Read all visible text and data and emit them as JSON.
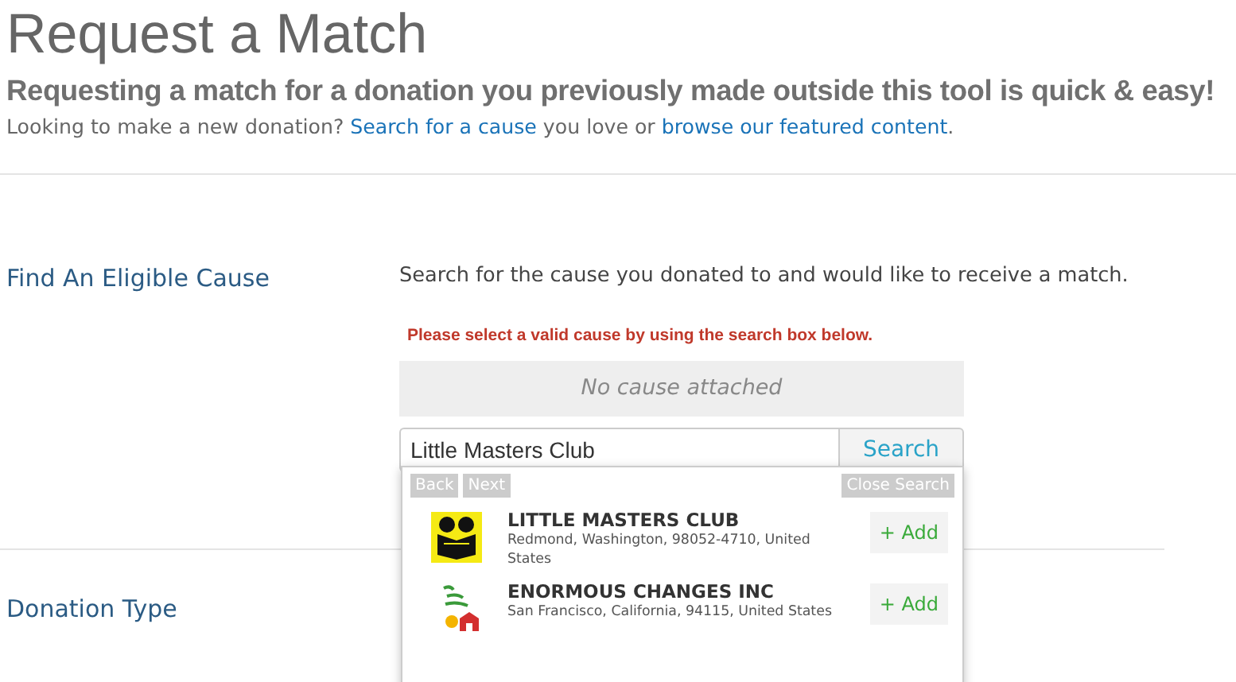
{
  "page": {
    "title": "Request a Match",
    "subtitle": "Requesting a match for a donation you previously made outside this tool is quick & easy!",
    "intro": [
      {
        "kind": "text",
        "text": "Looking to make a new donation? "
      },
      {
        "kind": "link",
        "text": "Search for a cause"
      },
      {
        "kind": "text",
        "text": " you love or "
      },
      {
        "kind": "link",
        "text": "browse our featured content"
      },
      {
        "kind": "text",
        "text": "."
      }
    ]
  },
  "find_cause": {
    "label": "Find An Eligible Cause",
    "instruction": "Search for the cause you donated to and would like to receive a match.",
    "error": "Please select a valid cause by using the search box below.",
    "attached": "No cause attached",
    "search": {
      "value": "Little Masters Club",
      "button": "Search"
    },
    "results_panel": {
      "back": "Back",
      "next": "Next",
      "close": "Close Search",
      "results": [
        {
          "kind": "book",
          "name": "LITTLE MASTERS CLUB",
          "address": "Redmond, Washington, 98052-4710, United States",
          "add": "+ Add"
        },
        {
          "kind": "school",
          "name": "ENORMOUS CHANGES INC",
          "address": "San Francisco, California, 94115, United States",
          "add": "+ Add"
        }
      ]
    }
  },
  "donation_type": {
    "label": "Donation Type"
  }
}
